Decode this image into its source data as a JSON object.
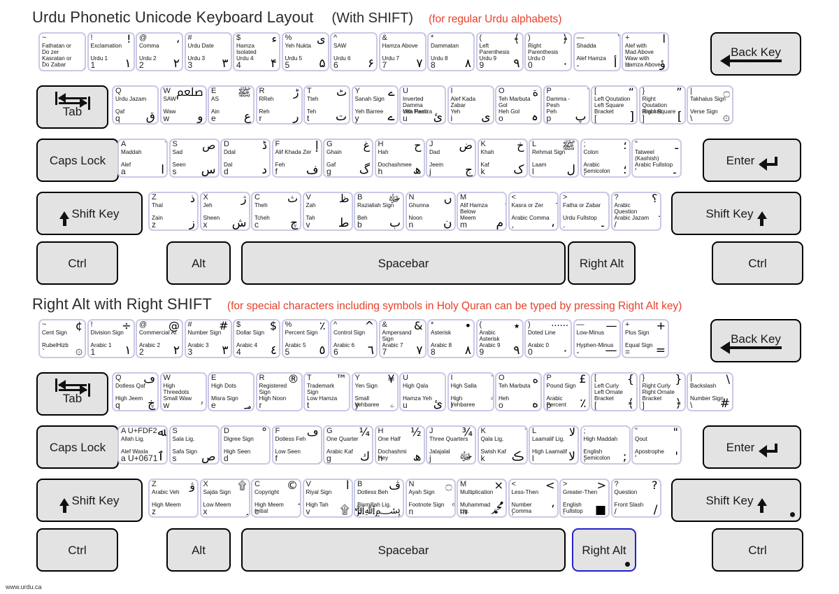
{
  "section1": {
    "title": "Urdu Phonetic Unicode Keyboard Layout",
    "subtitle": "(With SHIFT)",
    "note": "(for regular Urdu alphabets)",
    "note_color": "#e8402a"
  },
  "section2": {
    "title": "Right Alt with Right SHIFT",
    "note": "(for special characters including symbols in Holy Quran can be typed by pressing Right Alt key)",
    "note_color": "#e8402a"
  },
  "footer": "www.urdu.ca",
  "special_keys": {
    "back": "Back Key",
    "tab": "Tab",
    "caps": "Caps Lock",
    "enter": "Enter",
    "shift_left": "Shift Key",
    "shift_right": "Shift Key",
    "ctrl": "Ctrl",
    "alt": "Alt",
    "spacebar": "Spacebar",
    "right_alt": "Right Alt"
  },
  "kb1": {
    "row_num": [
      {
        "tl": "~",
        "tr": "ٰ",
        "l1": "Fathatan or",
        "l1b": "Do zer",
        "l2": "Kasratan or",
        "l2b": "Do Zabar",
        "bl": "`",
        "br": "ٍ"
      },
      {
        "tl": "!",
        "tr": "!",
        "l1": "Exclamation",
        "l2": "Urdu 1",
        "bl": "1",
        "br": "۱"
      },
      {
        "tl": "@",
        "tr": "،",
        "l1": "Comma",
        "l2": "Urdu 2",
        "bl": "2",
        "br": "۲"
      },
      {
        "tl": "#",
        "tr": "؜",
        "l1": "Urdu Date",
        "l2": "Urdu 3",
        "bl": "3",
        "br": "۳"
      },
      {
        "tl": "$",
        "tr": "ء",
        "l1": "Hamza",
        "l1b": "Isolated",
        "l2": "Urdu 4",
        "bl": "4",
        "br": "۴"
      },
      {
        "tl": "%",
        "tr": "ی",
        "l1": "Yeh Nukta",
        "l2": "Urdu 5",
        "bl": "5",
        "br": "۵"
      },
      {
        "tl": "^",
        "tr": "ؔ",
        "l1": "SAW",
        "l2": "Urdu 6",
        "bl": "6",
        "br": "۶"
      },
      {
        "tl": "&",
        "tr": "ٔ",
        "l1": "Hamza Above",
        "l2": "Urdu 7",
        "bl": "7",
        "br": "۷"
      },
      {
        "tl": "*",
        "tr": "ٌ",
        "l1": "Dammatan",
        "l2": "Urdu 8",
        "bl": "8",
        "br": "۸"
      },
      {
        "tl": "(",
        "tr": "﴾",
        "l1": "Left Parenthesis",
        "l2": "Urdu 9",
        "bl": "9",
        "br": "۹"
      },
      {
        "tl": ")",
        "tr": "﴿",
        "l1": "Right Parenthesis",
        "l2": "Urdu 0",
        "bl": "0",
        "br": "۰"
      },
      {
        "tl": "—",
        "tr": "ّ",
        "l1": "Shadda",
        "l2": "Alef Hamza",
        "bl": "-",
        "br": "أ"
      },
      {
        "tl": "+",
        "tr": "آ",
        "l1": "Alef with",
        "l1b": "Mad Above",
        "l2": "Waw with",
        "l2b": "Hamza Above",
        "bl": "=",
        "br": "ؤ"
      }
    ],
    "row_q": [
      {
        "tl": "Q",
        "tr": "ْ",
        "l1": "Urdu Jazam",
        "l2": "Qaf",
        "bl": "q",
        "br": "ق"
      },
      {
        "tl": "W",
        "tr": "ﷵ",
        "l1": "SAW",
        "l2": "Waw",
        "bl": "w",
        "br": "و"
      },
      {
        "tl": "E",
        "tr": "ﷺ",
        "l1": "AS",
        "l2": "Ain",
        "bl": "e",
        "br": "ع"
      },
      {
        "tl": "R",
        "tr": "ڑ",
        "l1": "RReh",
        "l2": "Reh",
        "bl": "r",
        "br": "ر"
      },
      {
        "tl": "T",
        "tr": "ٹ",
        "l1": "Tteh",
        "l2": "Teh",
        "bl": "t",
        "br": "ت"
      },
      {
        "tl": "Y",
        "tr": "ے",
        "l1": "Sanah Sign",
        "l2": "Yeh Barree",
        "bl": "y",
        "br": "ے"
      },
      {
        "tl": "U",
        "tr": "ٗ",
        "l1": "Inverted Damma",
        "l1b": "Ulta Pesh",
        "l2": "Yeh Hamza",
        "bl": "u",
        "br": "ئ"
      },
      {
        "tl": "I",
        "tr": "ٖ",
        "l1": "Alef Kada Zabar",
        "l2": "Yeh",
        "bl": "i",
        "br": "ی"
      },
      {
        "tl": "O",
        "tr": "ة",
        "l1": "Teh Marbuta",
        "l1b": "Gol",
        "l2": "Heh Gol",
        "bl": "o",
        "br": "ہ"
      },
      {
        "tl": "P",
        "tr": "ُ",
        "l1": "Damma - Pesh",
        "l2": "Peh",
        "bl": "p",
        "br": "پ"
      },
      {
        "tl": "[",
        "tr": "“",
        "l1": "Left Qoutation",
        "l1b": "Left Square",
        "l2": "Bracket",
        "bl": "[",
        "br": "["
      },
      {
        "tl": "}",
        "tr": "”",
        "l1": "Right Qoutation",
        "l1b": "Right Square",
        "l2": "Bracket",
        "bl": "]",
        "br": "]"
      },
      {
        "tl": "|",
        "tr": "۝",
        "l1": "Takhalus Sign",
        "l2": "Verse Sign",
        "bl": "\\",
        "br": "۞"
      }
    ],
    "row_a": [
      {
        "tl": "A",
        "tr": "ٓ",
        "l1": "Maddah",
        "l2": "Alef",
        "bl": "a",
        "br": "ا"
      },
      {
        "tl": "S",
        "tr": "ص",
        "l1": "Sad",
        "l2": "Seen",
        "bl": "s",
        "br": "س"
      },
      {
        "tl": "D",
        "tr": "ڈ",
        "l1": "Ddal",
        "l2": "Dal",
        "bl": "d",
        "br": "د"
      },
      {
        "tl": "F",
        "tr": "إ",
        "l1": "Alif Khada Zer",
        "l2": "Feh",
        "bl": "f",
        "br": "ف"
      },
      {
        "tl": "G",
        "tr": "غ",
        "l1": "Ghain",
        "l2": "Gaf",
        "bl": "g",
        "br": "گ"
      },
      {
        "tl": "H",
        "tr": "ح",
        "l1": "Hah",
        "l2": "Dochashmee",
        "bl": "h",
        "br": "ھ"
      },
      {
        "tl": "J",
        "tr": "ض",
        "l1": "Dad",
        "l2": "Jeem",
        "bl": "j",
        "br": "ج"
      },
      {
        "tl": "K",
        "tr": "خ",
        "l1": "Khah",
        "l2": "Kaf",
        "bl": "k",
        "br": "ک"
      },
      {
        "tl": "L",
        "tr": "ﷺ",
        "l1": "Rehmat Sign",
        "l2": "Laam",
        "bl": "l",
        "br": "ل"
      },
      {
        "tl": ";",
        "tr": "؛",
        "l1": "Colon",
        "l2": "Arabic Semicolon",
        "bl": ";",
        "br": "؛"
      },
      {
        "tl": "\"",
        "tr": "ـ",
        "l1": "Tatweel (Kashish)",
        "l2": "Arabic Fullstop",
        "bl": "'",
        "br": "۔"
      }
    ],
    "row_z": [
      {
        "tl": "Z",
        "tr": "ذ",
        "l1": "Thal",
        "l2": "Zain",
        "bl": "z",
        "br": "ز"
      },
      {
        "tl": "X",
        "tr": "ژ",
        "l1": "Jeh",
        "l2": "Sheen",
        "bl": "x",
        "br": "ش"
      },
      {
        "tl": "C",
        "tr": "ث",
        "l1": "Theh",
        "l2": "Tcheh",
        "bl": "c",
        "br": "چ"
      },
      {
        "tl": "V",
        "tr": "ظ",
        "l1": "Zah",
        "l2": "Tah",
        "bl": "v",
        "br": "ط"
      },
      {
        "tl": "B",
        "tr": "ﷻ",
        "l1": "Razialiah Sign",
        "l2": "Beh",
        "bl": "b",
        "br": "ب"
      },
      {
        "tl": "N",
        "tr": "ں",
        "l1": "Ghunna",
        "l2": "Noon",
        "bl": "n",
        "br": "ن"
      },
      {
        "tl": "M",
        "tr": "ٕ",
        "l1": "Alif Hamza",
        "l1b": "Below",
        "l2": "Meem",
        "bl": "m",
        "br": "م"
      },
      {
        "tl": "<",
        "tr": "ِ",
        "l1": "Kasra or Zer",
        "l2": "Arabic Comma",
        "bl": ",",
        "br": "،"
      },
      {
        "tl": ">",
        "tr": "َ",
        "l1": "Fatha or Zabar",
        "l2": "Urdu Fullstop",
        "bl": ".",
        "br": "۔"
      },
      {
        "tl": "?",
        "tr": "؟",
        "l1": "Arabic Question",
        "l2": "Arabic Jazam",
        "bl": "/",
        "br": "ۡ"
      }
    ]
  },
  "kb2": {
    "row_num": [
      {
        "tl": "~",
        "tr": "¢",
        "l1": "Cent Sign",
        "l2": "RubelHizb",
        "bl": "`",
        "br": "۞"
      },
      {
        "tl": "!",
        "tr": "÷",
        "l1": "Division Sign",
        "l2": "Arabic 1",
        "bl": "1",
        "br": "١"
      },
      {
        "tl": "@",
        "tr": "@",
        "l1": "Commercial At",
        "l2": "Arabic 2",
        "bl": "2",
        "br": "٢"
      },
      {
        "tl": "#",
        "tr": "#",
        "l1": "Number Sign",
        "l2": "Arabic 3",
        "bl": "3",
        "br": "٣"
      },
      {
        "tl": "$",
        "tr": "$",
        "l1": "Dollar Sign",
        "l2": "Arabic 4",
        "bl": "4",
        "br": "٤"
      },
      {
        "tl": "%",
        "tr": "٪",
        "l1": "Percent Sign",
        "l2": "Arabic 5",
        "bl": "5",
        "br": "٥"
      },
      {
        "tl": "^",
        "tr": "^",
        "l1": "Control Sign",
        "l2": "Arabic 6",
        "bl": "6",
        "br": "٦"
      },
      {
        "tl": "&",
        "tr": "&",
        "l1": "Ampersand Sign",
        "l2": "Arabic 7",
        "bl": "7",
        "br": "٧"
      },
      {
        "tl": "*",
        "tr": "•",
        "l1": "Asterisk",
        "l2": "Arabic 8",
        "bl": "8",
        "br": "٨"
      },
      {
        "tl": "(",
        "tr": "٭",
        "l1": "Arabic Asterisk",
        "l2": "Arabic 9",
        "bl": "9",
        "br": "٩"
      },
      {
        "tl": ")",
        "tr": "······",
        "l1": "Doted Line",
        "l2": "Arabic 0",
        "bl": "0",
        "br": "٠"
      },
      {
        "tl": "—",
        "tr": "—",
        "l1": "Low-Minus",
        "l2": "Hyphen-Minus",
        "bl": "-",
        "br": "—"
      },
      {
        "tl": "+",
        "tr": "+",
        "l1": "Plus Sign",
        "l2": "Equal Sign",
        "bl": "=",
        "br": "="
      }
    ],
    "row_q": [
      {
        "tl": "Q",
        "tr": "ڡ",
        "l1": "Dotless Qaf",
        "l2": "High Jeem",
        "bl": "q",
        "br": "ڿ"
      },
      {
        "tl": "W",
        "tr": "ۛ",
        "l1": "High Threedots",
        "l2": "Small Waw",
        "bl": "w",
        "br": "ۥ"
      },
      {
        "tl": "E",
        "tr": "۬",
        "l1": "High Dots",
        "l2": "Misra Sign",
        "bl": "e",
        "br": "؃"
      },
      {
        "tl": "R",
        "tr": "®",
        "l1": "Registered Sign",
        "l2": "High Noon",
        "bl": "r",
        "br": "ۨ"
      },
      {
        "tl": "T",
        "tr": "™",
        "l1": "Trademark Sign",
        "l2": "Low Hamza",
        "bl": "t",
        "br": "ٕ"
      },
      {
        "tl": "Y",
        "tr": "¥",
        "l1": "Yen Sign",
        "l2": "Small Yehbaree",
        "bl": "y",
        "br": "ۦ"
      },
      {
        "tl": "U",
        "tr": "ۡ",
        "l1": "High Qala",
        "l2": "Hamza Yeh",
        "bl": "u",
        "br": "ئ"
      },
      {
        "tl": "I",
        "tr": "ۖ",
        "l1": "High Salla",
        "l2": "High Yehbaree",
        "bl": "i",
        "br": "ۧ"
      },
      {
        "tl": "O",
        "tr": "ه",
        "l1": "Teh Marbuta",
        "l2": "Heh",
        "bl": "o",
        "br": "ه"
      },
      {
        "tl": "P",
        "tr": "£",
        "l1": "Pound Sign",
        "l2": "Arabic Percent",
        "bl": "p",
        "br": "٪"
      },
      {
        "tl": "[",
        "tr": "{",
        "l1": "Left Curly",
        "l1b": "Left Ornate",
        "l2": "Bracket",
        "bl": "[",
        "br": "﴾"
      },
      {
        "tl": "}",
        "tr": "}",
        "l1": "Right Curly",
        "l1b": "Right Ornate",
        "l2": "Bracket",
        "bl": "]",
        "br": "﴿"
      },
      {
        "tl": "|",
        "tr": "\\",
        "l1": "Backslash",
        "l2": "Number Sign",
        "bl": "\\",
        "br": "#"
      }
    ],
    "row_a": [
      {
        "tl": "A  U+FDF2",
        "tr": "ﷲ",
        "l1": "Allah Lig.",
        "l2": "Alef Wasla",
        "bl": "a  U+0671",
        "br": "ٱ"
      },
      {
        "tl": "S",
        "tr": "ؐ",
        "l1": "Sala Lig.",
        "l2": "Safa Sign",
        "bl": "s",
        "br": "ص"
      },
      {
        "tl": "D",
        "tr": "°",
        "l1": "Digree Sign",
        "l2": "High Seen",
        "bl": "d",
        "br": "ۢ"
      },
      {
        "tl": "F",
        "tr": "ڡ",
        "l1": "Dotless Feh",
        "l2": "Low Seen",
        "bl": "f",
        "br": "ۣ"
      },
      {
        "tl": "G",
        "tr": "¼",
        "l1": "One Quarter",
        "l2": "Arabic Kaf",
        "bl": "g",
        "br": "ك"
      },
      {
        "tl": "H",
        "tr": "½",
        "l1": "One Half",
        "l2": "Dochashmi Hey",
        "bl": "h",
        "br": "ھ"
      },
      {
        "tl": "J",
        "tr": "¾",
        "l1": "Three Quarters",
        "l2": "Jalajalal",
        "bl": "j",
        "br": "ﷻ"
      },
      {
        "tl": "K",
        "tr": "ۗ",
        "l1": "Qala Lig.",
        "l2": "Swish Kaf",
        "bl": "k",
        "br": "ڪ"
      },
      {
        "tl": "L",
        "tr": "ﻻ",
        "l1": "Laamalif Lig.",
        "l2": "High Laamalif",
        "bl": "l",
        "br": "ﻻ"
      },
      {
        "tl": ";",
        "tr": "ۤ",
        "l1": "High Maddah",
        "l2": "English Semicolon",
        "bl": ";",
        "br": ";"
      },
      {
        "tl": "\"",
        "tr": "\"",
        "l1": "Qout",
        "l2": "Apostrophe",
        "bl": "'",
        "br": "'"
      }
    ],
    "row_z": [
      {
        "tl": "Z",
        "tr": "ۋ",
        "l1": "Arabic Veh",
        "l2": "High Meem",
        "bl": "z",
        "br": "ۢ"
      },
      {
        "tl": "X",
        "tr": "۩",
        "l1": "Sajda Sign",
        "l2": "Low Meem",
        "bl": "x",
        "br": "ۭ"
      },
      {
        "tl": "C",
        "tr": "©",
        "l1": "Copyright",
        "l2": "High Meem Initial",
        "bl": "c",
        "br": "ۘ"
      },
      {
        "tl": "V",
        "tr": "أ",
        "l1": "Riyal Sign",
        "l2": "High Tah",
        "bl": "v",
        "br": "۩"
      },
      {
        "tl": "B",
        "tr": "ڤ",
        "l1": "Dotless Beh",
        "l2": "Bismillah Lig.",
        "bl": "b",
        "br": "﷽"
      },
      {
        "tl": "N",
        "tr": "۝",
        "l1": "Ayah Sign",
        "l2": "Footnote Sign",
        "bl": "n",
        "br": "۠"
      },
      {
        "tl": "M",
        "tr": "×",
        "l1": "Multiplication",
        "l2": "Muhammad Lig.",
        "bl": "m",
        "br": "ﷴ"
      },
      {
        "tl": "<",
        "tr": "<",
        "l1": "Less-Then",
        "l2": "Number Comma",
        "bl": ",",
        "br": "٬"
      },
      {
        "tl": ">",
        "tr": ">",
        "l1": "Greater-Then",
        "l2": "English Fullstop",
        "bl": ".",
        "br": "■"
      },
      {
        "tl": "?",
        "tr": "?",
        "l1": "Question",
        "l2": "Front Slash",
        "bl": "/",
        "br": "/"
      }
    ]
  }
}
